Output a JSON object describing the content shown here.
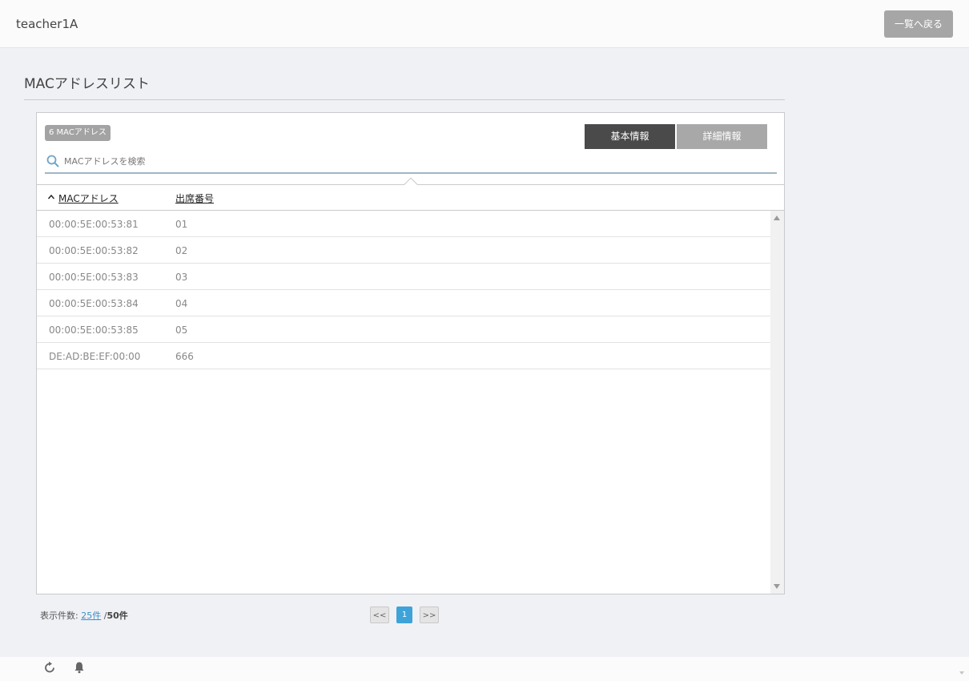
{
  "header": {
    "user": "teacher1A",
    "back_label": "一覧へ戻る"
  },
  "page": {
    "title": "MACアドレスリスト"
  },
  "panel": {
    "count_badge": "6 MACアドレス",
    "tabs": [
      {
        "label": "基本情報",
        "active": true
      },
      {
        "label": "詳細情報",
        "active": false
      }
    ],
    "search_placeholder": "MACアドレスを検索"
  },
  "table": {
    "columns": {
      "mac": "MACアドレス",
      "num": "出席番号"
    },
    "rows": [
      {
        "mac": "00:00:5E:00:53:81",
        "num": "01"
      },
      {
        "mac": "00:00:5E:00:53:82",
        "num": "02"
      },
      {
        "mac": "00:00:5E:00:53:83",
        "num": "03"
      },
      {
        "mac": "00:00:5E:00:53:84",
        "num": "04"
      },
      {
        "mac": "00:00:5E:00:53:85",
        "num": "05"
      },
      {
        "mac": "DE:AD:BE:EF:00:00",
        "num": "666"
      }
    ]
  },
  "footer": {
    "label": "表示件数:",
    "per_page": "25件",
    "separator": "/",
    "total": "50件"
  },
  "pager": {
    "prev": "<<",
    "current": "1",
    "next": ">>"
  },
  "colors": {
    "accent": "#3ea3d8",
    "tab_active": "#4a4a4a",
    "tab_inactive": "#a8a8a8",
    "badge": "#a3a3a3"
  }
}
